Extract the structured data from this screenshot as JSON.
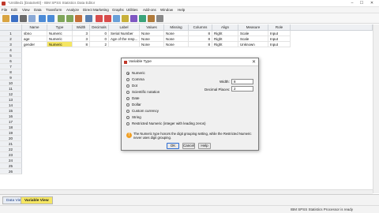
{
  "titlebar": {
    "title": "*Untitled1 [DataSet0] - IBM SPSS Statistics Data Editor"
  },
  "window_buttons": {
    "minimize": "–",
    "maximize": "☐",
    "close": "✕"
  },
  "menu": [
    "File",
    "Edit",
    "View",
    "Data",
    "Transform",
    "Analyze",
    "Direct Marketing",
    "Graphs",
    "Utilities",
    "Add-ons",
    "Window",
    "Help"
  ],
  "grid": {
    "columns": [
      "Name",
      "Type",
      "Width",
      "Decimals",
      "Label",
      "Values",
      "Missing",
      "Columns",
      "Align",
      "Measure",
      "Role"
    ],
    "rows": [
      {
        "num": "1",
        "name": "sbno",
        "type": "Numeric",
        "width": "3",
        "decimals": "0",
        "label": "Serial Number",
        "values": "None",
        "missing": "None",
        "columns": "8",
        "align": "Right",
        "measure": "Scale",
        "role": "Input"
      },
      {
        "num": "2",
        "name": "age",
        "type": "Numeric",
        "width": "3",
        "decimals": "0",
        "label": "Age of the resp...",
        "values": "None",
        "missing": "None",
        "columns": "8",
        "align": "Right",
        "measure": "Scale",
        "role": "Input"
      },
      {
        "num": "3",
        "name": "gender",
        "type": "Numeric",
        "width": "8",
        "decimals": "2",
        "label": "",
        "values": "None",
        "missing": "None",
        "columns": "8",
        "align": "Right",
        "measure": "Unknown",
        "role": "Input"
      }
    ],
    "empty_row_numbers": [
      "4",
      "5",
      "6",
      "7",
      "8",
      "9",
      "10",
      "11",
      "12",
      "13",
      "14",
      "15",
      "16",
      "17",
      "18",
      "19",
      "20",
      "21",
      "22",
      "23",
      "24",
      "25",
      "26"
    ]
  },
  "dialog": {
    "title": "Variable Type",
    "close": "✕",
    "options": [
      "Numeric",
      "Comma",
      "Dot",
      "Scientific notation",
      "Date",
      "Dollar",
      "Custom currency",
      "String",
      "Restricted Numeric (integer with leading zeros)"
    ],
    "selected": "Numeric",
    "width_label": "Width:",
    "width_value": "8",
    "decimals_label": "Decimal Places:",
    "decimals_value": "2",
    "info": "The Numeric type honors the digit grouping setting, while the Restricted Numeric never uses digit grouping.",
    "buttons": {
      "ok": "OK",
      "cancel": "Cancel",
      "help": "Help"
    }
  },
  "tabs": {
    "data_view": "Data View",
    "variable_view": "Variable View"
  },
  "status": {
    "text": "IBM SPSS Statistics Processor is ready"
  },
  "colors": {
    "selection": "#f5e663",
    "header": "#eef0f3",
    "tab_blue": "#1d3f86"
  }
}
